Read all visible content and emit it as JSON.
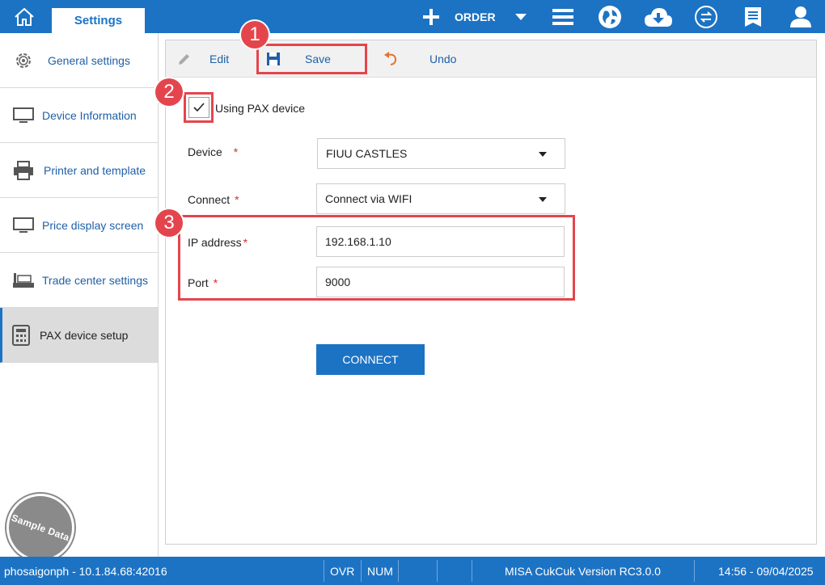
{
  "topbar": {
    "tab_label": "Settings",
    "order_label": "ORDER",
    "accent_color": "#1c73c4",
    "icons": [
      "home-icon",
      "plus-icon",
      "caret-down-icon",
      "menu-icon",
      "globe-icon",
      "cloud-download-icon",
      "sync-icon",
      "receipt-icon",
      "user-icon"
    ]
  },
  "sidebar": {
    "items": [
      {
        "label": "General settings",
        "icon": "gear-icon",
        "active": false
      },
      {
        "label": "Device Information",
        "icon": "monitor-icon",
        "active": false
      },
      {
        "label": "Printer and template",
        "icon": "printer-icon",
        "active": false
      },
      {
        "label": "Price display screen",
        "icon": "monitor-icon",
        "active": false
      },
      {
        "label": "Trade center settings",
        "icon": "mall-icon",
        "active": false
      },
      {
        "label": "PAX device setup",
        "icon": "calculator-icon",
        "active": true
      }
    ],
    "stamp_text": "Sample Data"
  },
  "toolbar": {
    "edit_label": "Edit",
    "save_label": "Save",
    "undo_label": "Undo"
  },
  "form": {
    "using_pax_label": "Using PAX device",
    "using_pax_checked": true,
    "device_label": "Device",
    "device_value": "FIUU CASTLES",
    "connect_label": "Connect",
    "connect_value": "Connect via WIFI",
    "ip_label": "IP address",
    "ip_value": "192.168.1.10",
    "port_label": "Port",
    "port_value": "9000",
    "required_mark": "*",
    "connect_button": "CONNECT"
  },
  "annotations": {
    "badge_1": "1",
    "badge_2": "2",
    "badge_3": "3",
    "highlight_color": "#e4454d"
  },
  "statusbar": {
    "user_host": "phosaigonph - 10.1.84.68:42016",
    "ovr": "OVR",
    "num": "NUM",
    "version": "MISA CukCuk Version RC3.0.0",
    "datetime": "14:56 - 09/04/2025"
  }
}
